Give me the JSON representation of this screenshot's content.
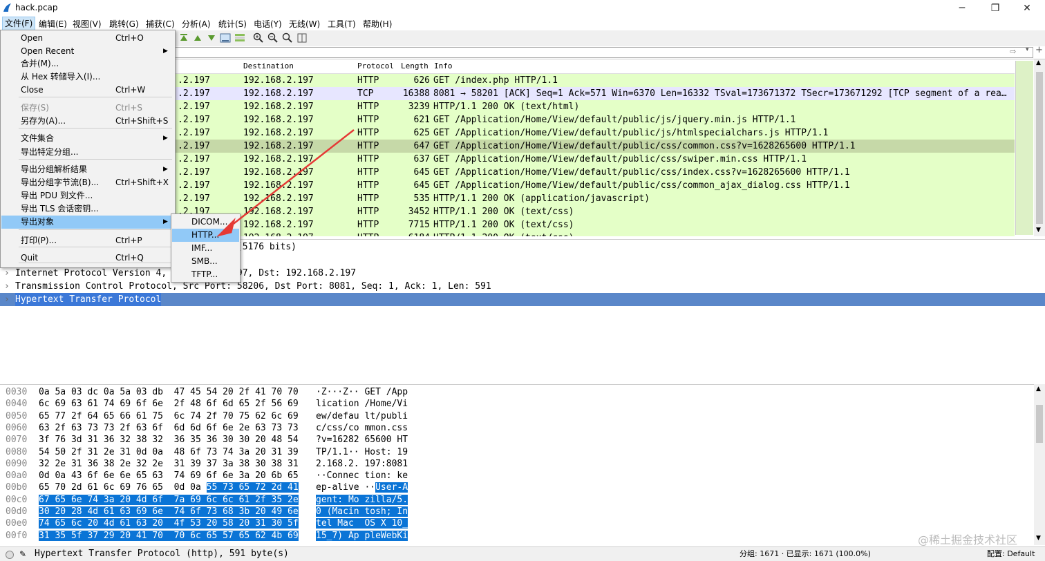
{
  "window": {
    "title": "hack.pcap",
    "minimize": "─",
    "restore": "❐",
    "close": "✕"
  },
  "menubar": [
    "文件(F)",
    "编辑(E)",
    "视图(V)",
    "跳转(G)",
    "捕获(C)",
    "分析(A)",
    "统计(S)",
    "电话(Y)",
    "无线(W)",
    "工具(T)",
    "帮助(H)"
  ],
  "packet_list": {
    "columns": [
      "Destination",
      "Protocol",
      "Length",
      "Info"
    ],
    "rows": [
      {
        "src": ".2.197",
        "dst": "192.168.2.197",
        "proto": "HTTP",
        "len": "626",
        "info": "GET /index.php HTTP/1.1",
        "bg": "#e4ffc7"
      },
      {
        "src": ".2.197",
        "dst": "192.168.2.197",
        "proto": "TCP",
        "len": "16388",
        "info": "8081 → 58201 [ACK] Seq=1 Ack=571 Win=6370 Len=16332 TSval=173671372 TSecr=173671292 [TCP segment of a rea…",
        "bg": "#e7e6ff"
      },
      {
        "src": ".2.197",
        "dst": "192.168.2.197",
        "proto": "HTTP",
        "len": "3239",
        "info": "HTTP/1.1 200 OK  (text/html)",
        "bg": "#e4ffc7"
      },
      {
        "src": ".2.197",
        "dst": "192.168.2.197",
        "proto": "HTTP",
        "len": "621",
        "info": "GET /Application/Home/View/default/public/js/jquery.min.js HTTP/1.1",
        "bg": "#e4ffc7"
      },
      {
        "src": ".2.197",
        "dst": "192.168.2.197",
        "proto": "HTTP",
        "len": "625",
        "info": "GET /Application/Home/View/default/public/js/htmlspecialchars.js HTTP/1.1",
        "bg": "#e4ffc7"
      },
      {
        "src": ".2.197",
        "dst": "192.168.2.197",
        "proto": "HTTP",
        "len": "647",
        "info": "GET /Application/Home/View/default/public/css/common.css?v=1628265600 HTTP/1.1",
        "bg": "#c6d9a8"
      },
      {
        "src": ".2.197",
        "dst": "192.168.2.197",
        "proto": "HTTP",
        "len": "637",
        "info": "GET /Application/Home/View/default/public/css/swiper.min.css HTTP/1.1",
        "bg": "#e4ffc7"
      },
      {
        "src": ".2.197",
        "dst": "192.168.2.197",
        "proto": "HTTP",
        "len": "645",
        "info": "GET /Application/Home/View/default/public/css/index.css?v=1628265600 HTTP/1.1",
        "bg": "#e4ffc7"
      },
      {
        "src": ".2.197",
        "dst": "192.168.2.197",
        "proto": "HTTP",
        "len": "645",
        "info": "GET /Application/Home/View/default/public/css/common_ajax_dialog.css HTTP/1.1",
        "bg": "#e4ffc7"
      },
      {
        "src": ".2.197",
        "dst": "192.168.2.197",
        "proto": "HTTP",
        "len": "535",
        "info": "HTTP/1.1 200 OK  (application/javascript)",
        "bg": "#e4ffc7"
      },
      {
        "src": ".2.197",
        "dst": "192.168.2.197",
        "proto": "HTTP",
        "len": "3452",
        "info": "HTTP/1.1 200 OK  (text/css)",
        "bg": "#e4ffc7"
      },
      {
        "src": ".2.197",
        "dst": "192.168.2.197",
        "proto": "HTTP",
        "len": "7715",
        "info": "HTTP/1.1 200 OK  (text/css)",
        "bg": "#e4ffc7"
      },
      {
        "src": ".2.197",
        "dst": "192.168.2.197",
        "proto": "HTTP",
        "len": "6184",
        "info": "HTTP/1.1 200 OK  (text/css)",
        "bg": "#e4ffc7"
      }
    ]
  },
  "details": [
    {
      "arrow": "",
      "text": "                       47 bytes captured (5176 bits)",
      "selected": false
    },
    {
      "arrow": "",
      "text": "",
      "selected": false
    },
    {
      "arrow": "›",
      "text": "Internet Protocol Version 4,         .2.197, Dst: 192.168.2.197",
      "selected": false
    },
    {
      "arrow": "›",
      "text": "Transmission Control Protocol, Src Port: 58206, Dst Port: 8081, Seq: 1, Ack: 1, Len: 591",
      "selected": false
    },
    {
      "arrow": "›",
      "text": "Hypertext Transfer Protocol",
      "selected": true
    }
  ],
  "bytes": [
    {
      "off": "0030",
      "hex": "0a 5a 03 dc 0a 5a 03 db  47 45 54 20 2f 41 70 70",
      "asc": "·Z···Z·· GET /App",
      "hexhl": "",
      "aschl": ""
    },
    {
      "off": "0040",
      "hex": "6c 69 63 61 74 69 6f 6e  2f 48 6f 6d 65 2f 56 69",
      "asc": "lication /Home/Vi",
      "hexhl": "",
      "aschl": ""
    },
    {
      "off": "0050",
      "hex": "65 77 2f 64 65 66 61 75  6c 74 2f 70 75 62 6c 69",
      "asc": "ew/defau lt/publi",
      "hexhl": "",
      "aschl": ""
    },
    {
      "off": "0060",
      "hex": "63 2f 63 73 73 2f 63 6f  6d 6d 6f 6e 2e 63 73 73",
      "asc": "c/css/co mmon.css",
      "hexhl": "",
      "aschl": ""
    },
    {
      "off": "0070",
      "hex": "3f 76 3d 31 36 32 38 32  36 35 36 30 30 20 48 54",
      "asc": "?v=16282 65600 HT",
      "hexhl": "",
      "aschl": ""
    },
    {
      "off": "0080",
      "hex": "54 50 2f 31 2e 31 0d 0a  48 6f 73 74 3a 20 31 39",
      "asc": "TP/1.1·· Host: 19",
      "hexhl": "",
      "aschl": ""
    },
    {
      "off": "0090",
      "hex": "32 2e 31 36 38 2e 32 2e  31 39 37 3a 38 30 38 31",
      "asc": "2.168.2. 197:8081",
      "hexhl": "",
      "aschl": ""
    },
    {
      "off": "00a0",
      "hex": "0d 0a 43 6f 6e 6e 65 63  74 69 6f 6e 3a 20 6b 65",
      "asc": "··Connec tion: ke",
      "hexhl": "",
      "aschl": ""
    },
    {
      "off": "00b0",
      "hex": "65 70 2d 61 6c 69 76 65  0d 0a ",
      "asc": "ep-alive ··",
      "hexhl": "55 73 65 72 2d 41",
      "aschl": "User-A"
    },
    {
      "off": "00c0",
      "hex": "",
      "asc": "",
      "hexhl": "67 65 6e 74 3a 20 4d 6f  7a 69 6c 6c 61 2f 35 2e",
      "aschl": "gent: Mo zilla/5."
    },
    {
      "off": "00d0",
      "hex": "",
      "asc": "",
      "hexhl": "30 20 28 4d 61 63 69 6e  74 6f 73 68 3b 20 49 6e",
      "aschl": "0 (Macin tosh; In"
    },
    {
      "off": "00e0",
      "hex": "",
      "asc": "",
      "hexhl": "74 65 6c 20 4d 61 63 20  4f 53 20 58 20 31 30 5f",
      "aschl": "tel Mac  OS X 10_"
    },
    {
      "off": "00f0",
      "hex": "",
      "asc": "",
      "hexhl": "31 35 5f 37 29 20 41 70  70 6c 65 57 65 62 4b 69",
      "aschl": "15_7) Ap pleWebKi"
    }
  ],
  "status": {
    "proto": "Hypertext Transfer Protocol (http), 591 byte(s)",
    "packets": "分组: 1671 · 已显示: 1671 (100.0%)",
    "profile": "配置: Default"
  },
  "file_menu": [
    {
      "label": "Open",
      "shortcut": "Ctrl+O",
      "sub": false,
      "disabled": false
    },
    {
      "label": "Open Recent",
      "shortcut": "",
      "sub": true,
      "disabled": false
    },
    {
      "label": "合并(M)...",
      "shortcut": "",
      "sub": false,
      "disabled": false
    },
    {
      "label": "从 Hex 转储导入(I)...",
      "shortcut": "",
      "sub": false,
      "disabled": false
    },
    {
      "label": "Close",
      "shortcut": "Ctrl+W",
      "sub": false,
      "disabled": false
    },
    {
      "label": "保存(S)",
      "shortcut": "Ctrl+S",
      "sub": false,
      "disabled": true
    },
    {
      "label": "另存为(A)...",
      "shortcut": "Ctrl+Shift+S",
      "sub": false,
      "disabled": false
    },
    {
      "label": "文件集合",
      "shortcut": "",
      "sub": true,
      "disabled": false
    },
    {
      "label": "导出特定分组...",
      "shortcut": "",
      "sub": false,
      "disabled": false
    },
    {
      "label": "导出分组解析结果",
      "shortcut": "",
      "sub": true,
      "disabled": false
    },
    {
      "label": "导出分组字节流(B)...",
      "shortcut": "Ctrl+Shift+X",
      "sub": false,
      "disabled": false
    },
    {
      "label": "导出 PDU 到文件...",
      "shortcut": "",
      "sub": false,
      "disabled": false
    },
    {
      "label": "导出 TLS 会话密钥...",
      "shortcut": "",
      "sub": false,
      "disabled": false
    },
    {
      "label": "导出对象",
      "shortcut": "",
      "sub": true,
      "disabled": false
    },
    {
      "label": "打印(P)...",
      "shortcut": "Ctrl+P",
      "sub": false,
      "disabled": false
    },
    {
      "label": "Quit",
      "shortcut": "Ctrl+Q",
      "sub": false,
      "disabled": false
    }
  ],
  "export_submenu": [
    "DICOM...",
    "HTTP...",
    "IMF...",
    "SMB...",
    "TFTP..."
  ],
  "watermark": "@稀土掘金技术社区",
  "colors": {
    "http_row": "#e4ffc7",
    "tcp_row": "#e7e6ff",
    "selected_detail": "#5a87c9",
    "hex_highlight": "#0a74d6",
    "arrow": "#e53935"
  }
}
